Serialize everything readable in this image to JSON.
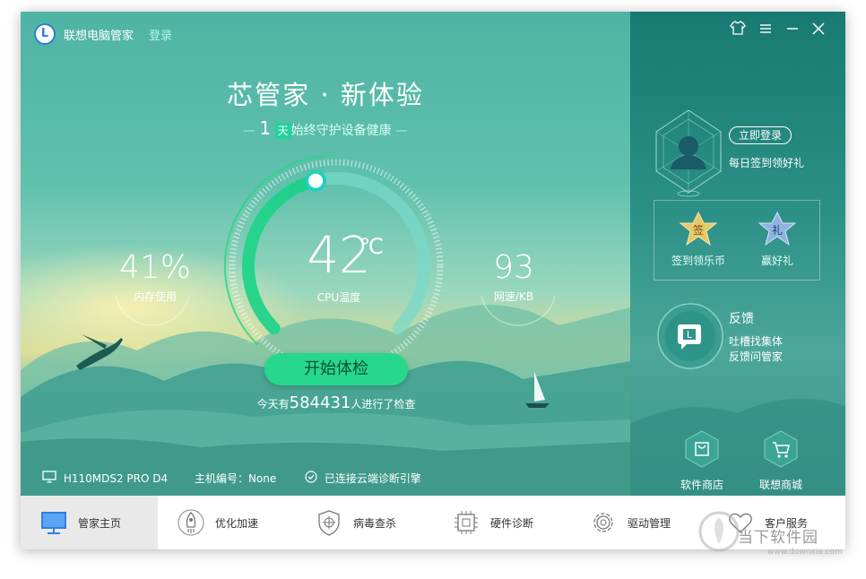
{
  "app": {
    "name": "联想电脑管家",
    "login_link": "登录"
  },
  "window_controls": {
    "skin_icon": "shirt-icon",
    "menu_icon": "menu-icon",
    "minimize_icon": "minimize-icon",
    "close_icon": "close-icon"
  },
  "hero": {
    "title": "芯管家 · 新体验",
    "days": "1",
    "day_badge": "天",
    "subtitle": "始终守护设备健康"
  },
  "gauge": {
    "temperature": "42",
    "unit": "℃",
    "label": "CPU温度",
    "progress": 0.45
  },
  "stats": {
    "memory_value": "41%",
    "memory_label": "内存使用",
    "network_value": "93",
    "network_label": "网速/KB"
  },
  "scan": {
    "button_label": "开始体检",
    "count_prefix": "今天有",
    "count_value": "584431",
    "count_suffix": "人进行了检查"
  },
  "status": {
    "model": "H110MDS2 PRO D4",
    "host_id": "主机编号：None",
    "cloud": "已连接云端诊断引擎"
  },
  "account": {
    "login_button": "立即登录",
    "daily_text": "每日签到领好礼"
  },
  "rewards": {
    "sign_badge": "签",
    "sign_label": "签到领乐币",
    "gift_badge": "礼",
    "gift_label": "赢好礼"
  },
  "feedback": {
    "title": "反馈",
    "line1": "吐槽找集体",
    "line2": "反馈问管家"
  },
  "shops": {
    "software": "软件商店",
    "lenovo": "联想商城"
  },
  "nav": [
    {
      "label": "管家主页",
      "icon": "monitor-icon",
      "active": true
    },
    {
      "label": "优化加速",
      "icon": "rocket-icon",
      "active": false
    },
    {
      "label": "病毒查杀",
      "icon": "shield-icon",
      "active": false
    },
    {
      "label": "硬件诊断",
      "icon": "chip-icon",
      "active": false
    },
    {
      "label": "驱动管理",
      "icon": "gear-icon",
      "active": false
    },
    {
      "label": "客户服务",
      "icon": "heart-icon",
      "active": false
    }
  ],
  "watermark": {
    "text": "当下软件园",
    "url": "www.downxia.com"
  },
  "colors": {
    "accent_green": "#27d88c",
    "teal_dark": "#187a72",
    "login_link": "#b5f7e6"
  }
}
